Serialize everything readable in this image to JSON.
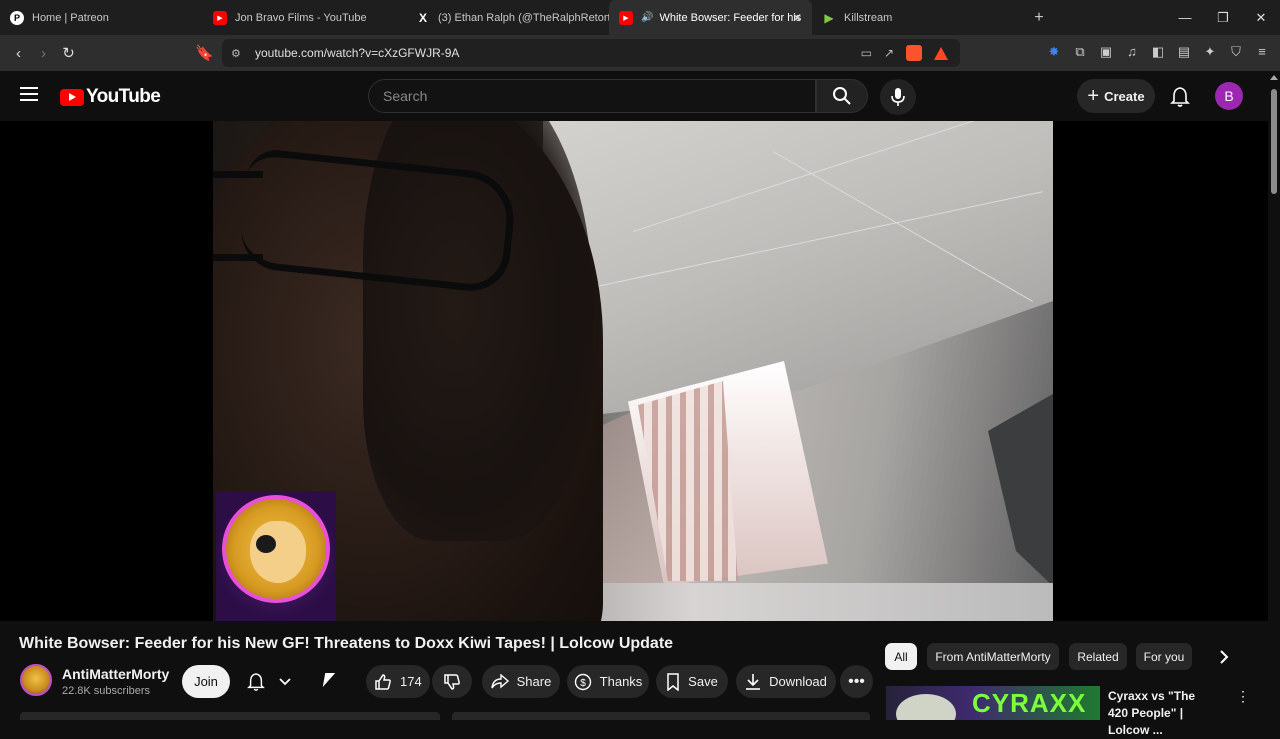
{
  "browser": {
    "tabs": [
      {
        "label": "Home | Patreon",
        "icon": "patreon-icon",
        "active": false
      },
      {
        "label": "Jon Bravo Films - YouTube",
        "icon": "youtube-icon",
        "active": false
      },
      {
        "label": "(3) Ethan Ralph (@TheRalphRetort) /",
        "icon": "x-icon",
        "active": false
      },
      {
        "label": "White Bowser: Feeder for his",
        "icon": "youtube-icon",
        "active": true
      },
      {
        "label": "Killstream",
        "icon": "rumble-icon",
        "active": false
      }
    ],
    "new_tab": "+",
    "url": "youtube.com/watch?v=cXzGFWJR-9A",
    "colors": {
      "tabbar": "#1e1e1e",
      "toolbar": "#2e2e2e",
      "brave_orange": "#fb542b"
    }
  },
  "youtube": {
    "logo_text": "YouTube",
    "search_placeholder": "Search",
    "create_label": "Create",
    "avatar_letter": "B",
    "colors": {
      "brand_red": "#ff0000",
      "avatar": "#9c27b0",
      "bg": "#0f0f0f"
    }
  },
  "video": {
    "title": "White Bowser: Feeder for his New GF! Threatens to Doxx Kiwi Tapes! | Lolcow Update",
    "channel_name": "AntiMatterMorty",
    "subscribers": "22.8K subscribers",
    "join_label": "Join",
    "like_count": "174",
    "share_label": "Share",
    "thanks_label": "Thanks",
    "save_label": "Save",
    "download_label": "Download"
  },
  "sidebar": {
    "chips": [
      "All",
      "From AntiMatterMorty",
      "Related",
      "For you"
    ],
    "recommendation": {
      "thumb_text": "CYRAXX",
      "title": "Cyraxx vs \"The 420 People\" | Lolcow ..."
    }
  }
}
